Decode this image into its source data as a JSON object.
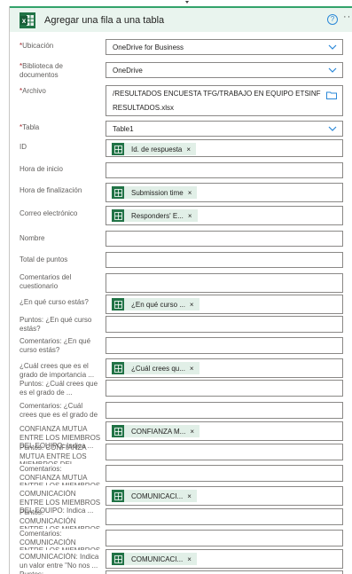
{
  "header": {
    "title": "Agregar una fila a una tabla",
    "help_icon": "question-circle-icon",
    "more_icon": "ellipsis-icon",
    "brand_color": "#217346"
  },
  "required_mark": "*",
  "fields": {
    "ubicacion": {
      "label": "Ubicación",
      "value": "OneDrive for Business"
    },
    "biblioteca": {
      "label": "Biblioteca de documentos",
      "value": "OneDrive"
    },
    "archivo": {
      "label": "Archivo",
      "value_line1": "/RESULTADOS ENCUESTA TFG/TRABAJO EN EQUIPO ETSINF",
      "value_line2": "RESULTADOS.xlsx"
    },
    "tabla": {
      "label": "Tabla",
      "value": "Table1"
    },
    "id": {
      "label": "ID",
      "token": "Id. de respuesta"
    },
    "hora_inicio": {
      "label": "Hora de inicio"
    },
    "hora_fin": {
      "label": "Hora de finalización",
      "token": "Submission time"
    },
    "correo": {
      "label": "Correo electrónico",
      "token": "Responders' E..."
    },
    "nombre": {
      "label": "Nombre"
    },
    "total_puntos": {
      "label": "Total de puntos"
    },
    "comentarios_cuestionario": {
      "label": "Comentarios del cuestionario"
    },
    "curso": {
      "label": "¿En qué curso estás?",
      "token": "¿En qué curso ..."
    },
    "puntos_curso": {
      "label": "Puntos: ¿En qué curso estás?"
    },
    "comentarios_curso": {
      "label": "Comentarios: ¿En qué curso estás?"
    },
    "grado": {
      "label": "¿Cuál crees que es el grado de importancia ...",
      "token": "¿Cuál crees qu..."
    },
    "puntos_grado": {
      "label": "Puntos: ¿Cuál crees que es el grado de ..."
    },
    "comentarios_grado": {
      "label": "Comentarios: ¿Cuál crees que es el grado de ..."
    },
    "confianza": {
      "label": "CONFIANZA MUTUA ENTRE LOS MIEMBROS DEL EQUIPO: Indica ...",
      "token": "CONFIANZA M..."
    },
    "puntos_confianza": {
      "label": "Puntos: CONFIANZA MUTUA ENTRE LOS MIEMBROS DEL ..."
    },
    "comentarios_confianza": {
      "label": "Comentarios: CONFIANZA MUTUA ENTRE LOS MIEMBROS ..."
    },
    "comunicacion": {
      "label": "COMUNICACIÓN ENTRE LOS MIEMBROS DEL EQUIPO: Indica ...",
      "token": "COMUNICACI..."
    },
    "puntos_comunicacion": {
      "label": "Puntos: COMUNICACIÓN ENTRE LOS MIEMBROS DEL ..."
    },
    "comentarios_comunicacion": {
      "label": "Comentarios: COMUNICACIÓN ENTRE LOS MIEMBROS DEL ..."
    },
    "comunicacion_valor": {
      "label": "COMUNICACIÓN: Indica un valor entre \"No nos ...",
      "token": "COMUNICACI..."
    },
    "puntos_last": {
      "label": "Puntos:"
    }
  },
  "token_remove": "×"
}
